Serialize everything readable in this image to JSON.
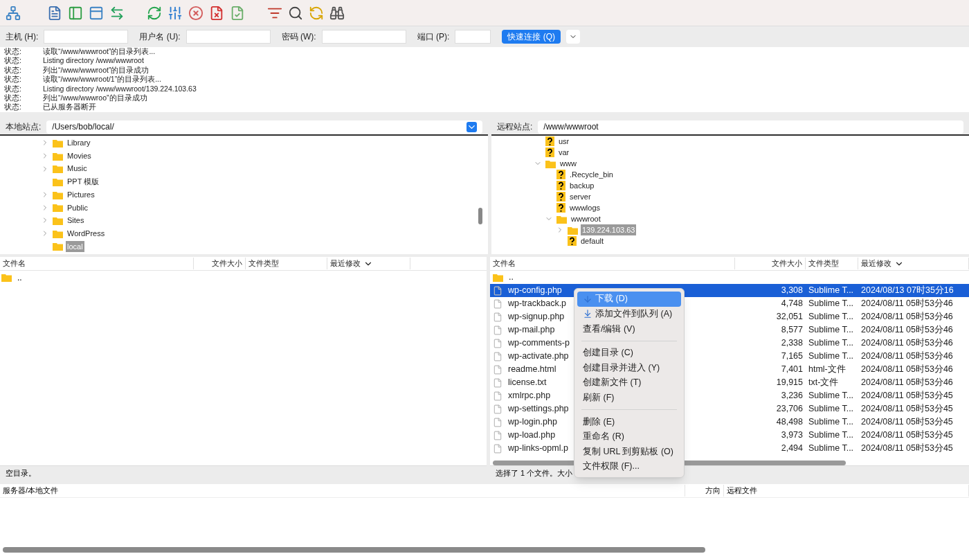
{
  "quickconnect": {
    "fields": [
      {
        "label": "主机 (H):"
      },
      {
        "label": "用户名 (U):"
      },
      {
        "label": "密码 (W):"
      },
      {
        "label": "端口 (P):"
      }
    ],
    "button": "快速连接 (Q)"
  },
  "log": [
    {
      "label": "状态:",
      "message": "读取“/www/wwwroot”的目录列表..."
    },
    {
      "label": "状态:",
      "message": "Listing directory /www/wwwroot"
    },
    {
      "label": "状态:",
      "message": "列出“/www/wwwroot”的目录成功"
    },
    {
      "label": "状态:",
      "message": "读取“/www/wwwroot/1”的目录列表..."
    },
    {
      "label": "状态:",
      "message": "Listing directory /www/wwwroot/139.224.103.63"
    },
    {
      "label": "状态:",
      "message": "列出“/www/wwwroo”的目录成功"
    },
    {
      "label": "状态:",
      "message": "已从服务器断开"
    }
  ],
  "local": {
    "site_label": "本地站点:",
    "path": "/Users/bob/local/",
    "tree": [
      {
        "name": "Library",
        "kind": "folder",
        "has_children": true,
        "selected": false
      },
      {
        "name": "Movies",
        "kind": "folder",
        "has_children": true,
        "selected": false
      },
      {
        "name": "Music",
        "kind": "folder",
        "has_children": true,
        "selected": false
      },
      {
        "name": "PPT 模版",
        "kind": "folder",
        "has_children": false,
        "selected": false
      },
      {
        "name": "Pictures",
        "kind": "folder",
        "has_children": true,
        "selected": false
      },
      {
        "name": "Public",
        "kind": "folder",
        "has_children": true,
        "selected": false
      },
      {
        "name": "Sites",
        "kind": "folder",
        "has_children": true,
        "selected": false
      },
      {
        "name": "WordPress",
        "kind": "folder",
        "has_children": true,
        "selected": false
      },
      {
        "name": "local",
        "kind": "folder",
        "has_children": false,
        "selected": true
      }
    ],
    "columns": [
      "文件名",
      "文件大小",
      "文件类型",
      "最近修改"
    ],
    "rows": [
      {
        "name": "..",
        "kind": "folder",
        "size": "",
        "type": "",
        "modified": "",
        "selected": false
      }
    ],
    "status": "空目录。"
  },
  "remote": {
    "site_label": "远程站点:",
    "path": "/www/wwwroot",
    "tree": [
      {
        "name": "usr",
        "kind": "unknown",
        "has_children": false,
        "selected": false
      },
      {
        "name": "var",
        "kind": "unknown",
        "has_children": false,
        "selected": false
      },
      {
        "name": "www",
        "kind": "folder",
        "has_children": true,
        "expanded": true,
        "selected": false,
        "children": [
          {
            "name": ".Recycle_bin",
            "kind": "unknown",
            "has_children": false,
            "selected": false
          },
          {
            "name": "backup",
            "kind": "unknown",
            "has_children": false,
            "selected": false
          },
          {
            "name": "server",
            "kind": "unknown",
            "has_children": false,
            "selected": false
          },
          {
            "name": "wwwlogs",
            "kind": "unknown",
            "has_children": false,
            "selected": false
          },
          {
            "name": "wwwroot",
            "kind": "folder",
            "has_children": true,
            "expanded": true,
            "selected": false,
            "children": [
              {
                "name": "139.224.103.63",
                "kind": "folder",
                "has_children": true,
                "expanded": false,
                "selected": true
              },
              {
                "name": "default",
                "kind": "unknown",
                "has_children": false,
                "selected": false
              }
            ]
          }
        ]
      }
    ],
    "columns": [
      "文件名",
      "文件大小",
      "文件类型",
      "最近修改"
    ],
    "rows": [
      {
        "name": "..",
        "kind": "folder",
        "size": "",
        "type": "",
        "modified": "",
        "selected": false
      },
      {
        "name": "wp-config.php",
        "kind": "file",
        "size": "3,308",
        "type": "Sublime T...",
        "modified": "2024/08/13 07时35分16",
        "selected": true
      },
      {
        "name": "wp-trackback.p",
        "kind": "file",
        "size": "4,748",
        "type": "Sublime T...",
        "modified": "2024/08/11 05时53分46",
        "selected": false
      },
      {
        "name": "wp-signup.php",
        "kind": "file",
        "size": "32,051",
        "type": "Sublime T...",
        "modified": "2024/08/11 05时53分46",
        "selected": false
      },
      {
        "name": "wp-mail.php",
        "kind": "file",
        "size": "8,577",
        "type": "Sublime T...",
        "modified": "2024/08/11 05时53分46",
        "selected": false
      },
      {
        "name": "wp-comments-p",
        "kind": "file",
        "size": "2,338",
        "type": "Sublime T...",
        "modified": "2024/08/11 05时53分46",
        "selected": false
      },
      {
        "name": "wp-activate.php",
        "kind": "file",
        "size": "7,165",
        "type": "Sublime T...",
        "modified": "2024/08/11 05时53分46",
        "selected": false
      },
      {
        "name": "readme.html",
        "kind": "file",
        "size": "7,401",
        "type": "html-文件",
        "modified": "2024/08/11 05时53分46",
        "selected": false
      },
      {
        "name": "license.txt",
        "kind": "file",
        "size": "19,915",
        "type": "txt-文件",
        "modified": "2024/08/11 05时53分46",
        "selected": false
      },
      {
        "name": "xmlrpc.php",
        "kind": "file",
        "size": "3,236",
        "type": "Sublime T...",
        "modified": "2024/08/11 05时53分45",
        "selected": false
      },
      {
        "name": "wp-settings.php",
        "kind": "file",
        "size": "23,706",
        "type": "Sublime T...",
        "modified": "2024/08/11 05时53分45",
        "selected": false
      },
      {
        "name": "wp-login.php",
        "kind": "file",
        "size": "48,498",
        "type": "Sublime T...",
        "modified": "2024/08/11 05时53分45",
        "selected": false
      },
      {
        "name": "wp-load.php",
        "kind": "file",
        "size": "3,973",
        "type": "Sublime T...",
        "modified": "2024/08/11 05时53分45",
        "selected": false
      },
      {
        "name": "wp-links-opml.p",
        "kind": "file",
        "size": "2,494",
        "type": "Sublime T...",
        "modified": "2024/08/11 05时53分45",
        "selected": false
      }
    ],
    "status": "选择了 1 个文件。大小"
  },
  "context_menu": [
    {
      "kind": "download",
      "label": "下载 (D)",
      "selected": true
    },
    {
      "kind": "queue",
      "label": "添加文件到队列 (A)",
      "selected": false
    },
    {
      "kind": "item",
      "label": "查看/编辑 (V)",
      "selected": false
    },
    {
      "kind": "separator"
    },
    {
      "kind": "item",
      "label": "创建目录 (C)",
      "selected": false
    },
    {
      "kind": "item",
      "label": "创建目录并进入 (Y)",
      "selected": false
    },
    {
      "kind": "item",
      "label": "创建新文件 (T)",
      "selected": false
    },
    {
      "kind": "item",
      "label": "刷新 (F)",
      "selected": false
    },
    {
      "kind": "separator"
    },
    {
      "kind": "item",
      "label": "删除 (E)",
      "selected": false
    },
    {
      "kind": "item",
      "label": "重命名 (R)",
      "selected": false
    },
    {
      "kind": "item",
      "label": "复制 URL 到剪贴板 (O)",
      "selected": false
    },
    {
      "kind": "item",
      "label": "文件权限 (F)...",
      "selected": false
    }
  ],
  "queue": {
    "columns": [
      "服务器/本地文件",
      "方向",
      "远程文件"
    ]
  }
}
